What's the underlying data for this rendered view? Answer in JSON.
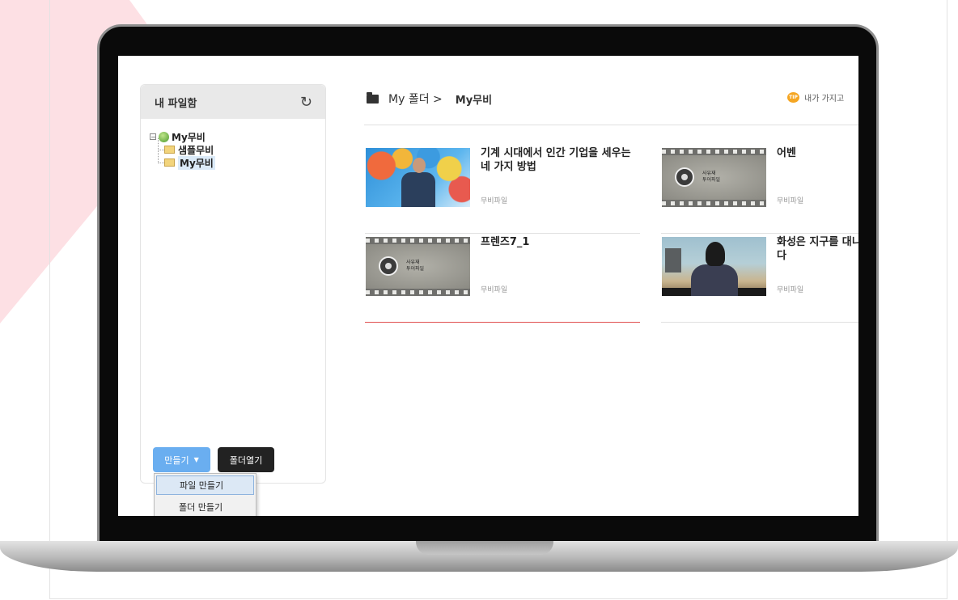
{
  "sidebar": {
    "title": "내 파일함",
    "tree": {
      "root": "My무비",
      "toggle": "−",
      "children": [
        "샘플무비",
        "My무비"
      ]
    },
    "create_button": "만들기",
    "open_folder_button": "폴더열기",
    "dropdown": [
      "파일 만들기",
      "폴더 만들기"
    ]
  },
  "breadcrumb": {
    "parent": "My 폴더 >",
    "current": "My무비"
  },
  "tip": {
    "badge": "TIP",
    "text": "내가 가지고"
  },
  "cards": [
    {
      "title": "기계 시대에서 인간 기업을 세우는 네 가지 방법",
      "type": "무비파일",
      "thumb_caption": ""
    },
    {
      "title": "어벤",
      "type": "무비파일",
      "thumb_caption": "사유재\n투어파일"
    },
    {
      "title": "프렌즈7_1",
      "type": "무비파일",
      "thumb_caption": "사유재\n투어파일"
    },
    {
      "title": "화성은 지구를 대니다",
      "type": "무비파일",
      "thumb_caption": ""
    }
  ],
  "icons": {
    "refresh": "refresh-icon",
    "folder": "folder-icon",
    "globe": "globe-icon",
    "caret": "caret-down-icon",
    "tip": "tip-icon"
  },
  "colors": {
    "accent_blue": "#6aaef0",
    "dark_button": "#222222",
    "active_underline": "#e05050",
    "tip_orange": "#f5a623"
  }
}
